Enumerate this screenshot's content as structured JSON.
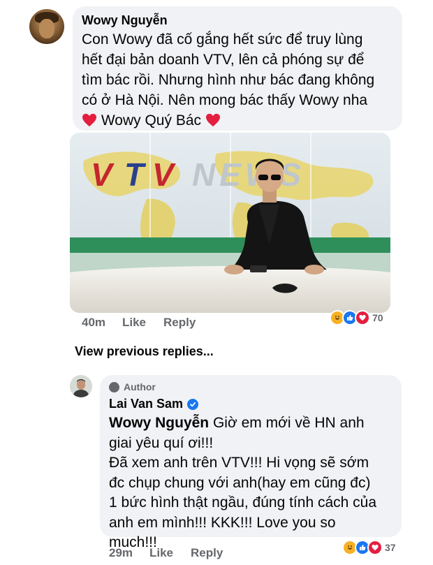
{
  "comment1": {
    "author": "Wowy Nguyễn",
    "text_lines": [
      "Con Wowy đã cố gắng hết sức để truy lùng",
      "hết đại bản doanh VTV, lên cả phóng sự để",
      "tìm bác rồi. Nhưng hình như bác đang không",
      "có ở Hà Nội. Nên mong bác thấy Wowy nha"
    ],
    "last_line_text": "Wowy Quý Bác",
    "image_caption_text": "VTV NEWS",
    "time": "40m",
    "like_label": "Like",
    "reply_label": "Reply",
    "reaction_count": "70"
  },
  "view_previous": "View previous replies...",
  "reply": {
    "badge_label": "Author",
    "author": "Lai Van Sam",
    "mention": "Wowy Nguyễn",
    "text_lines": [
      " Giờ em mới về HN anh",
      "giai yêu quí ơi!!!",
      "Đã xem anh trên VTV!!! Hi vọng sẽ sớm",
      "đc chụp chung với anh(hay em cũng đc)",
      "1 bức hình thật ngầu, đúng tính cách của",
      "anh em mình!!! KKK!!! Love you so",
      "much!!!"
    ],
    "time": "29m",
    "like_label": "Like",
    "reply_label": "Reply",
    "reaction_count": "37"
  },
  "icons": {
    "heart_color": "#e41e3f",
    "like_color": "#1877f2",
    "haha_color": "#f7b125",
    "verified_color": "#1877f2"
  }
}
